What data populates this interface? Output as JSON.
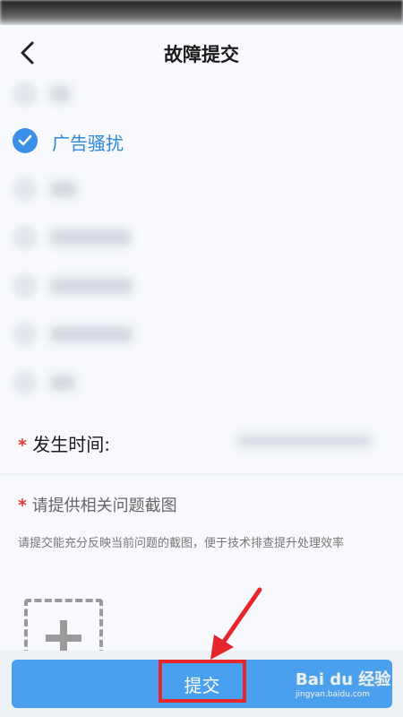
{
  "header": {
    "title": "故障提交"
  },
  "options": {
    "selected_label": "广告骚扰"
  },
  "time_field": {
    "required_mark": "*",
    "label": "发生时间:"
  },
  "screenshot_section": {
    "required_mark": "*",
    "label": "请提供相关问题截图",
    "hint": "请提交能充分反映当前问题的截图，便于技术排查提升处理效率"
  },
  "footer": {
    "submit_label": "提交"
  },
  "watermark": {
    "brand": "Bai du 经验",
    "sub": "jingyan.baidu.com"
  },
  "colors": {
    "accent": "#4aa0ef",
    "checked": "#3b8fe6",
    "required": "#e23b35",
    "annotation": "#e5262b"
  }
}
